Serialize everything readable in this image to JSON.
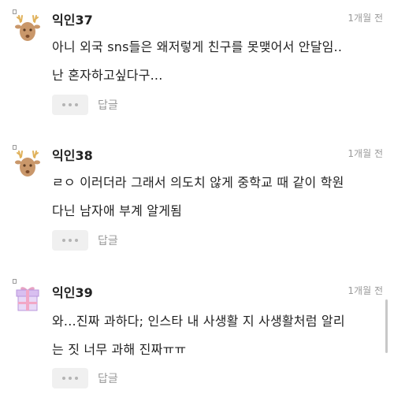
{
  "comments": [
    {
      "author": "익인37",
      "time": "1개월 전",
      "avatar_icon": "reindeer-icon",
      "text": "아니 외국 sns들은 왜저렇게 친구를 못맺어서 안달임..\n난 혼자하고싶다구...",
      "more_label": "more-options",
      "reply_label": "답글"
    },
    {
      "author": "익인38",
      "time": "1개월 전",
      "avatar_icon": "reindeer-icon",
      "text": "ㄹㅇ 이러더라 그래서 의도치 않게 중학교 때 같이 학원\n다닌 남자애 부계 알게됨",
      "more_label": "more-options",
      "reply_label": "답글"
    },
    {
      "author": "익인39",
      "time": "1개월 전",
      "avatar_icon": "gift-box-icon",
      "text": "와...진짜 과하다; 인스타 내 사생활 지 사생활처럼 알리\n는 짓 너무 과해 진짜ㅠㅠ",
      "more_label": "more-options",
      "reply_label": "답글"
    }
  ],
  "colors": {
    "text": "#222222",
    "muted": "#9a9a9a",
    "reindeer": "#c9976a",
    "antler": "#e0b15a",
    "gift": "#c7a8e6"
  }
}
